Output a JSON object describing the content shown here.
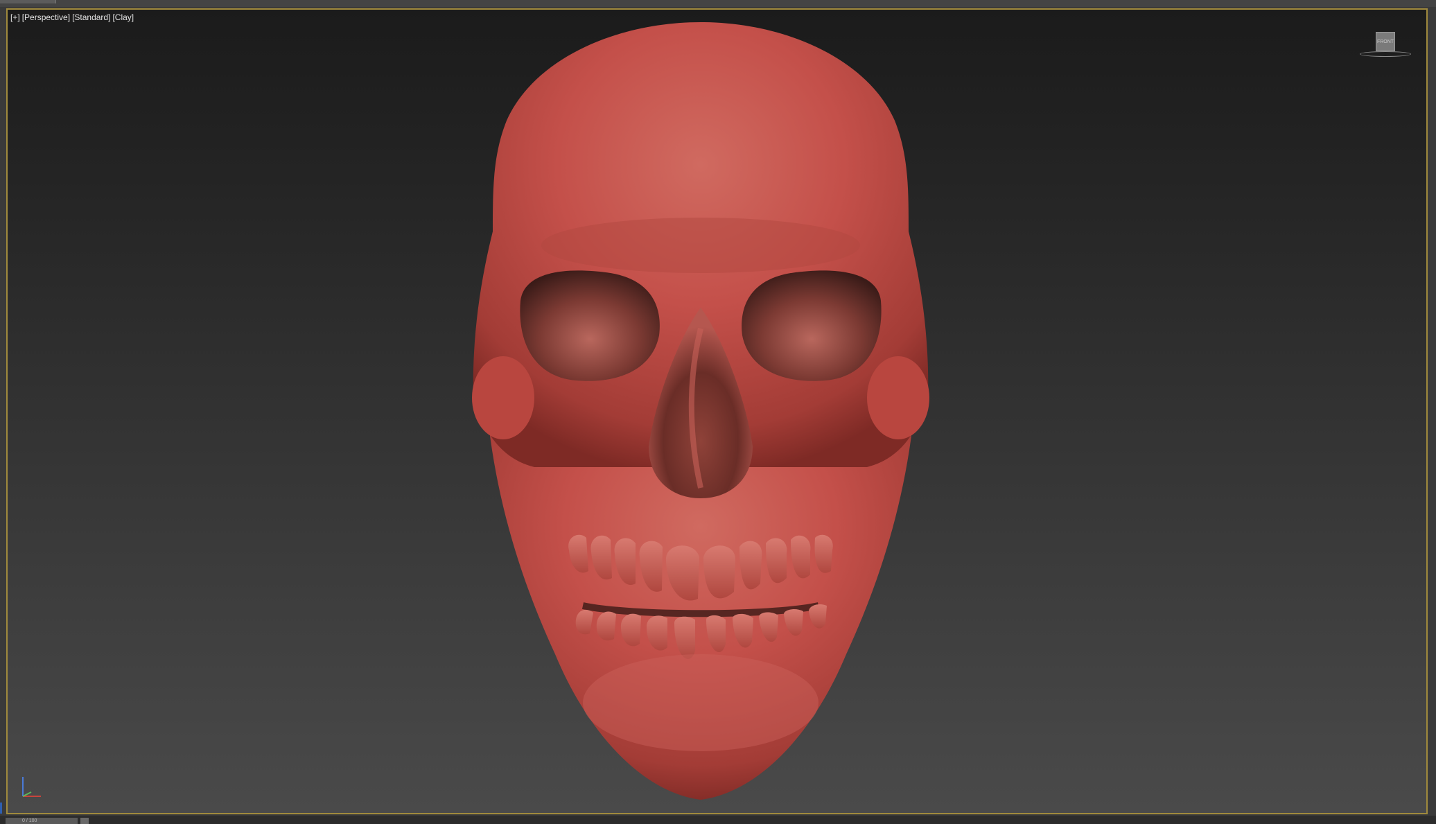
{
  "viewport": {
    "label_plus": "[+]",
    "label_view": "[Perspective]",
    "label_shading": "[Standard]",
    "label_style": "[Clay]",
    "border_color": "#a08a3d"
  },
  "viewcube": {
    "face_label": "FRONT"
  },
  "timeline": {
    "frame_label": "0 / 100"
  },
  "scene": {
    "object": "skull-model",
    "material_color": "#c4504a"
  }
}
